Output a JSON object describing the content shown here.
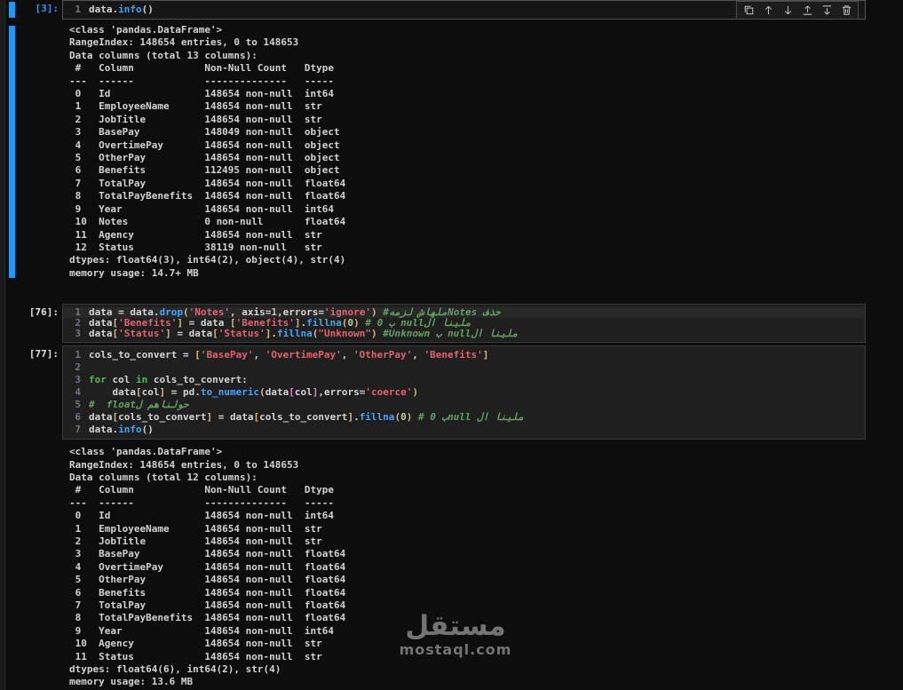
{
  "window": {
    "bg": "#0d0d0d",
    "accent": "#2196f3",
    "active_prompt_color": "#3d95e8",
    "prompt_color": "#e3e3e3"
  },
  "cell_toolbar": {
    "buttons": [
      {
        "icon": "copy-icon",
        "label": "duplicate-cell"
      },
      {
        "icon": "arrow-up-icon",
        "label": "move-cell-up"
      },
      {
        "icon": "arrow-down-icon",
        "label": "move-cell-down"
      },
      {
        "icon": "insert-above-icon",
        "label": "insert-cell-above"
      },
      {
        "icon": "insert-below-icon",
        "label": "insert-cell-below"
      },
      {
        "icon": "trash-icon",
        "label": "delete-cell"
      }
    ]
  },
  "cells": [
    {
      "prompt": "[3]:",
      "active": true,
      "has_toolbar": true,
      "margin_class": "",
      "out_margin_class": "mt-out1",
      "lines": [
        {
          "no": "1",
          "tokens": [
            [
              "data",
              "id"
            ],
            [
              ".",
              "p"
            ],
            [
              "info",
              "fn"
            ],
            [
              "()",
              "p"
            ]
          ]
        }
      ],
      "output": [
        "<class 'pandas.DataFrame'>",
        "RangeIndex: 148654 entries, 0 to 148653",
        "Data columns (total 13 columns):",
        " #   Column            Non-Null Count   Dtype  ",
        "---  ------            --------------   -----  ",
        " 0   Id                148654 non-null  int64  ",
        " 1   EmployeeName      148654 non-null  str    ",
        " 2   JobTitle          148654 non-null  str    ",
        " 3   BasePay           148049 non-null  object ",
        " 4   OvertimePay       148654 non-null  object ",
        " 5   OtherPay          148654 non-null  object ",
        " 6   Benefits          112495 non-null  object ",
        " 7   TotalPay          148654 non-null  float64",
        " 8   TotalPayBenefits  148654 non-null  float64",
        " 9   Year              148654 non-null  int64  ",
        " 10  Notes             0 non-null       float64",
        " 11  Agency            148654 non-null  str    ",
        " 12  Status            38119 non-null   str    ",
        "dtypes: float64(3), int64(2), object(4), str(4)",
        "memory usage: 14.7+ MB"
      ]
    },
    {
      "prompt": "[76]:",
      "active": false,
      "compact": true,
      "margin_class": "mt-c76",
      "lines": [
        {
          "no": "1",
          "hl": true,
          "tokens": [
            [
              "data",
              "id"
            ],
            [
              " = ",
              "op"
            ],
            [
              "data",
              "id"
            ],
            [
              ".",
              "p"
            ],
            [
              "drop",
              "fn"
            ],
            [
              "(",
              "b1"
            ],
            [
              "'Notes'",
              "str"
            ],
            [
              ", ",
              "p"
            ],
            [
              "axis",
              "id"
            ],
            [
              "=",
              "op"
            ],
            [
              "1",
              "num"
            ],
            [
              ",",
              "p"
            ],
            [
              "errors",
              "id"
            ],
            [
              "=",
              "op"
            ],
            [
              "'ignore'",
              "str"
            ],
            [
              ")",
              "b1"
            ],
            [
              " ",
              "p"
            ],
            [
              "#⁧حذف Notesملهاش لزمه⁩",
              "cm"
            ]
          ]
        },
        {
          "no": "2",
          "tokens": [
            [
              "data",
              "id"
            ],
            [
              "[",
              "b1"
            ],
            [
              "'Benefits'",
              "str"
            ],
            [
              "]",
              "b1"
            ],
            [
              " = ",
              "op"
            ],
            [
              "data",
              "id"
            ],
            [
              " ",
              "p"
            ],
            [
              "[",
              "b1"
            ],
            [
              "'Benefits'",
              "str"
            ],
            [
              "]",
              "b1"
            ],
            [
              ".",
              "p"
            ],
            [
              "fillna",
              "fn"
            ],
            [
              "(",
              "b1"
            ],
            [
              "0",
              "num"
            ],
            [
              ")",
              "b1"
            ],
            [
              " ",
              "p"
            ],
            [
              "# ⁧ملينا الnull ب 0⁩",
              "cm"
            ]
          ]
        },
        {
          "no": "3",
          "tokens": [
            [
              "data",
              "id"
            ],
            [
              "[",
              "b1"
            ],
            [
              "'Status'",
              "str"
            ],
            [
              "]",
              "b1"
            ],
            [
              " = ",
              "op"
            ],
            [
              "data",
              "id"
            ],
            [
              "[",
              "b1"
            ],
            [
              "'Status'",
              "str"
            ],
            [
              "]",
              "b1"
            ],
            [
              ".",
              "p"
            ],
            [
              "fillna",
              "fn"
            ],
            [
              "(",
              "b1"
            ],
            [
              "\"Unknown\"",
              "str"
            ],
            [
              ")",
              "b1"
            ],
            [
              " ",
              "p"
            ],
            [
              "#⁧ملينا الnull ب Unknown⁩",
              "cm"
            ]
          ]
        }
      ]
    },
    {
      "prompt": "[77]:",
      "active": false,
      "margin_class": "mt-c77",
      "out_margin_class": "mt-out2",
      "lines": [
        {
          "no": "1",
          "tokens": [
            [
              "cols_to_convert",
              "id"
            ],
            [
              " = ",
              "op"
            ],
            [
              "[",
              "b1"
            ],
            [
              "'BasePay'",
              "str"
            ],
            [
              ", ",
              "p"
            ],
            [
              "'OvertimePay'",
              "str"
            ],
            [
              ", ",
              "p"
            ],
            [
              "'OtherPay'",
              "str"
            ],
            [
              ", ",
              "p"
            ],
            [
              "'Benefits'",
              "str"
            ],
            [
              "]",
              "b1"
            ]
          ]
        },
        {
          "no": "2",
          "tokens": []
        },
        {
          "no": "3",
          "tokens": [
            [
              "for",
              "kw"
            ],
            [
              " ",
              "p"
            ],
            [
              "col",
              "id"
            ],
            [
              " ",
              "p"
            ],
            [
              "in",
              "kw"
            ],
            [
              " ",
              "p"
            ],
            [
              "cols_to_convert",
              "id"
            ],
            [
              ":",
              "p"
            ]
          ]
        },
        {
          "no": "4",
          "tokens": [
            [
              "    ",
              "p"
            ],
            [
              "data",
              "id"
            ],
            [
              "[",
              "b1"
            ],
            [
              "col",
              "id"
            ],
            [
              "]",
              "b1"
            ],
            [
              " = ",
              "op"
            ],
            [
              "pd",
              "id"
            ],
            [
              ".",
              "p"
            ],
            [
              "to_numeric",
              "fn"
            ],
            [
              "(",
              "b1"
            ],
            [
              "data",
              "id"
            ],
            [
              "[",
              "b2"
            ],
            [
              "col",
              "id"
            ],
            [
              "]",
              "b2"
            ],
            [
              ",",
              "p"
            ],
            [
              "errors",
              "id"
            ],
            [
              "=",
              "op"
            ],
            [
              "'coerce'",
              "str"
            ],
            [
              ")",
              "b1"
            ]
          ]
        },
        {
          "no": "5",
          "tokens": [
            [
              "#  ⁧حولناهم لfloat⁩",
              "cm"
            ]
          ]
        },
        {
          "no": "6",
          "tokens": [
            [
              "data",
              "id"
            ],
            [
              "[",
              "b1"
            ],
            [
              "cols_to_convert",
              "id"
            ],
            [
              "]",
              "b1"
            ],
            [
              " = ",
              "op"
            ],
            [
              "data",
              "id"
            ],
            [
              "[",
              "b1"
            ],
            [
              "cols_to_convert",
              "id"
            ],
            [
              "]",
              "b1"
            ],
            [
              ".",
              "p"
            ],
            [
              "fillna",
              "fn"
            ],
            [
              "(",
              "b1"
            ],
            [
              "0",
              "num"
            ],
            [
              ")",
              "b1"
            ],
            [
              " ",
              "p"
            ],
            [
              "# ⁧ملينا ال nullب 0⁩",
              "cm"
            ]
          ]
        },
        {
          "no": "7",
          "tokens": [
            [
              "data",
              "id"
            ],
            [
              ".",
              "p"
            ],
            [
              "info",
              "fn"
            ],
            [
              "()",
              "p"
            ]
          ]
        }
      ],
      "output": [
        "<class 'pandas.DataFrame'>",
        "RangeIndex: 148654 entries, 0 to 148653",
        "Data columns (total 12 columns):",
        " #   Column            Non-Null Count   Dtype  ",
        "---  ------            --------------   -----  ",
        " 0   Id                148654 non-null  int64  ",
        " 1   EmployeeName      148654 non-null  str    ",
        " 2   JobTitle          148654 non-null  str    ",
        " 3   BasePay           148654 non-null  float64",
        " 4   OvertimePay       148654 non-null  float64",
        " 5   OtherPay          148654 non-null  float64",
        " 6   Benefits          148654 non-null  float64",
        " 7   TotalPay          148654 non-null  float64",
        " 8   TotalPayBenefits  148654 non-null  float64",
        " 9   Year              148654 non-null  int64  ",
        " 10  Agency            148654 non-null  str    ",
        " 11  Status            148654 non-null  str    ",
        "dtypes: float64(6), int64(2), str(4)",
        "memory usage: 13.6 MB"
      ]
    }
  ],
  "watermark": {
    "logo": "مستقل",
    "domain": "mostaql.com"
  }
}
